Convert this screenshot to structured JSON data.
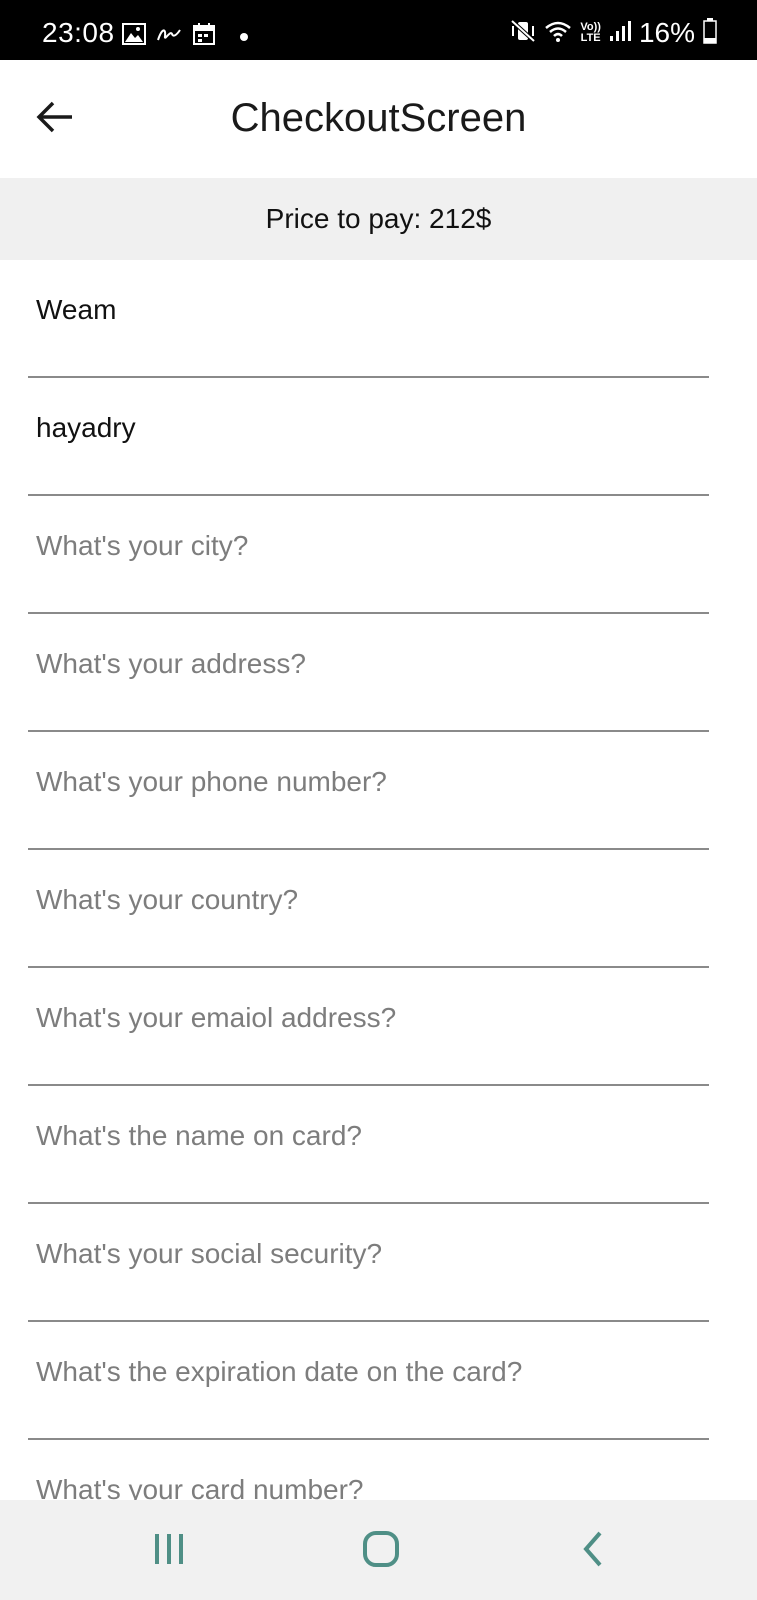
{
  "status_bar": {
    "time": "23:08",
    "battery": "16%",
    "icons_left": [
      "gallery-icon",
      "signature-icon",
      "calendar-icon",
      "dot-icon"
    ],
    "icons_right": [
      "mute-vibrate-icon",
      "wifi-icon",
      "volte-icon",
      "signal-icon",
      "battery-icon"
    ],
    "volte_label_top": "Vo))",
    "volte_label_bottom": "LTE"
  },
  "app_bar": {
    "title": "CheckoutScreen",
    "back_icon": "arrow-left-icon"
  },
  "price_banner": {
    "text": "Price to pay: 212$"
  },
  "form": {
    "fields": [
      {
        "value": "Weam",
        "placeholder": ""
      },
      {
        "value": "hayadry",
        "placeholder": ""
      },
      {
        "value": "",
        "placeholder": "What's your city?"
      },
      {
        "value": "",
        "placeholder": "What's your address?"
      },
      {
        "value": "",
        "placeholder": "What's your phone number?"
      },
      {
        "value": "",
        "placeholder": "What's your country?"
      },
      {
        "value": "",
        "placeholder": "What's your emaiol address?"
      },
      {
        "value": "",
        "placeholder": "What's the name on card?"
      },
      {
        "value": "",
        "placeholder": "What's your social security?"
      },
      {
        "value": "",
        "placeholder": "What's the expiration date on the card?"
      },
      {
        "value": "",
        "placeholder": "What's your card number?"
      }
    ]
  },
  "nav_bar": {
    "icons": [
      "recent-apps-icon",
      "home-icon",
      "back-icon"
    ],
    "color": "#4f8f86"
  },
  "colors": {
    "status_bar_bg": "#000000",
    "banner_bg": "#f0f0f0",
    "nav_bg": "#f1f1f1",
    "placeholder": "#7d7d7d",
    "underline": "#8a8a8a"
  }
}
